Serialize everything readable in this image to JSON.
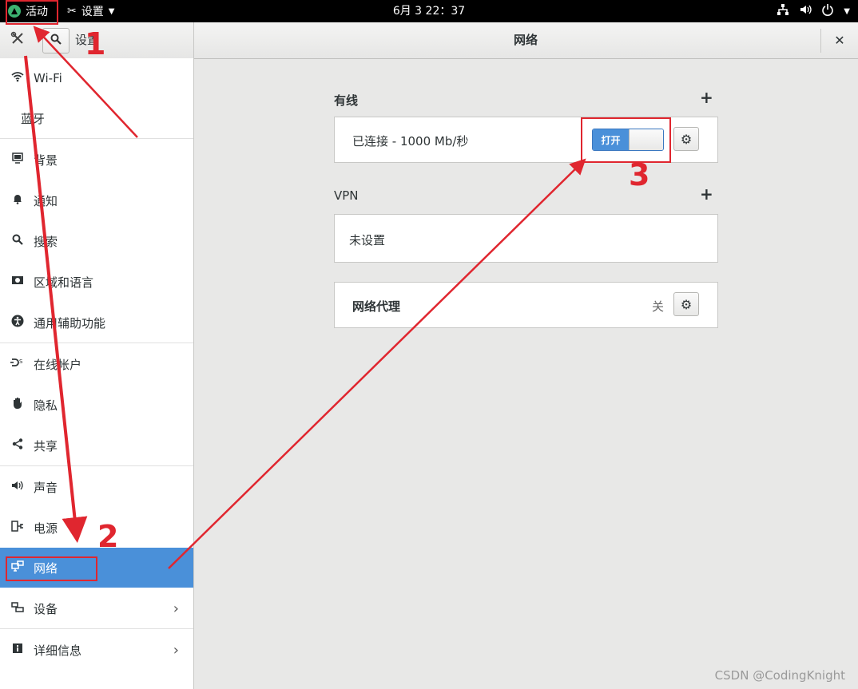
{
  "topbar": {
    "activities": "活动",
    "app_menu": "设置",
    "clock": "6月 3  22：37"
  },
  "headerbar": {
    "sidebar_title": "设置",
    "main_title": "网络"
  },
  "sidebar": {
    "items": [
      {
        "label": "Wi-Fi",
        "icon": "wifi-icon"
      },
      {
        "label": "蓝牙",
        "icon": ""
      },
      {
        "label": "背景",
        "icon": "background-icon"
      },
      {
        "label": "通知",
        "icon": "bell-icon"
      },
      {
        "label": "搜索",
        "icon": "search-icon"
      },
      {
        "label": "区域和语言",
        "icon": "region-icon"
      },
      {
        "label": "通用辅助功能",
        "icon": "accessibility-icon"
      },
      {
        "label": "在线帐户",
        "icon": "online-accounts-icon"
      },
      {
        "label": "隐私",
        "icon": "hand-icon"
      },
      {
        "label": "共享",
        "icon": "share-icon"
      },
      {
        "label": "声音",
        "icon": "speaker-icon"
      },
      {
        "label": "电源",
        "icon": "power-plug-icon"
      },
      {
        "label": "网络",
        "icon": "network-icon",
        "selected": true
      },
      {
        "label": "设备",
        "icon": "devices-icon"
      },
      {
        "label": "详细信息",
        "icon": "info-icon"
      }
    ]
  },
  "main": {
    "wired": {
      "label": "有线",
      "status": "已连接 - 1000 Mb/秒",
      "toggle_label": "打开",
      "toggle_on": true
    },
    "vpn": {
      "label": "VPN",
      "status": "未设置"
    },
    "proxy": {
      "label": "网络代理",
      "value": "关"
    }
  },
  "annotations": {
    "step1": "1",
    "step2": "2",
    "step3": "3",
    "color": "#e0262f"
  },
  "watermark": "CSDN @CodingKnight",
  "colors": {
    "accent": "#4a90d9",
    "topbar": "#000000",
    "background": "#e8e8e7"
  }
}
